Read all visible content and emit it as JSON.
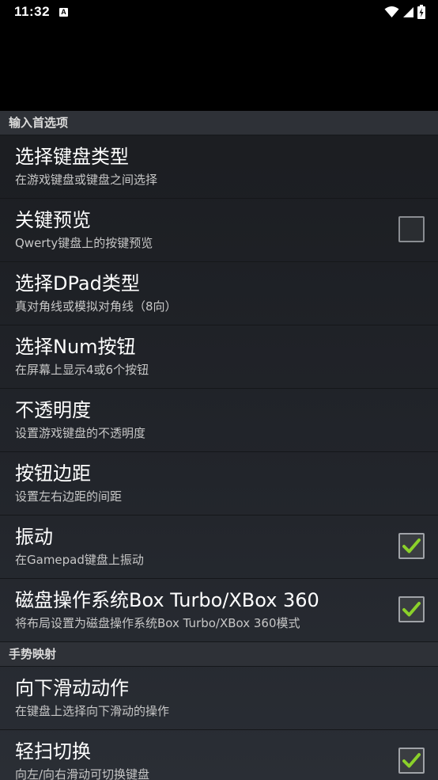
{
  "status_bar": {
    "time": "11:32",
    "notification_icon": "A",
    "icons": [
      "wifi-icon",
      "signal-icon",
      "battery-charging-icon"
    ]
  },
  "sections": [
    {
      "header": "输入首选项",
      "items": [
        {
          "title": "选择键盘类型",
          "subtitle": "在游戏键盘或键盘之间选择",
          "checkbox": null
        },
        {
          "title": "关键预览",
          "subtitle": "Qwerty键盘上的按键预览",
          "checkbox": false
        },
        {
          "title": "选择DPad类型",
          "subtitle": "真对角线或模拟对角线（8向）",
          "checkbox": null
        },
        {
          "title": "选择Num按钮",
          "subtitle": "在屏幕上显示4或6个按钮",
          "checkbox": null
        },
        {
          "title": "不透明度",
          "subtitle": "设置游戏键盘的不透明度",
          "checkbox": null
        },
        {
          "title": "按钮边距",
          "subtitle": "设置左右边距的间距",
          "checkbox": null
        },
        {
          "title": "振动",
          "subtitle": "在Gamepad键盘上振动",
          "checkbox": true
        },
        {
          "title": "磁盘操作系统Box Turbo/XBox 360",
          "subtitle": "将布局设置为磁盘操作系统Box Turbo/XBox 360模式",
          "checkbox": true
        }
      ]
    },
    {
      "header": "手势映射",
      "items": [
        {
          "title": "向下滑动动作",
          "subtitle": "在键盘上选择向下滑动的操作",
          "checkbox": null
        },
        {
          "title": "轻扫切换",
          "subtitle": "向左/向右滑动可切换键盘",
          "checkbox": true
        }
      ]
    }
  ],
  "colors": {
    "background": "#000000",
    "list_background": "#1b1d21",
    "header_background": "#2e3137",
    "check_color": "#8bd12a"
  }
}
